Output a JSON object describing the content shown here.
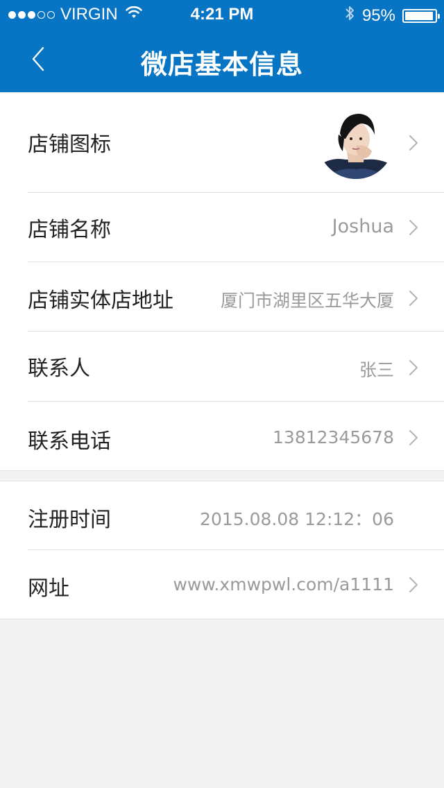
{
  "status_bar": {
    "carrier": "VIRGIN",
    "time": "4:21 PM",
    "battery_percent": "95%",
    "battery_level": 0.95,
    "signal_bars_filled": 3,
    "signal_bars_total": 5,
    "icons": [
      "wifi-icon",
      "bluetooth-icon",
      "battery-icon"
    ]
  },
  "nav": {
    "title": "微店基本信息",
    "back_icon": "chevron-left-icon"
  },
  "rows": {
    "shop_icon": {
      "label": "店铺图标",
      "value_type": "avatar-image"
    },
    "shop_name": {
      "label": "店铺名称",
      "value": "Joshua"
    },
    "shop_address": {
      "label": "店铺实体店地址",
      "value": "厦门市湖里区五华大厦"
    },
    "contact": {
      "label": "联系人",
      "value": "张三"
    },
    "phone": {
      "label": "联系电话",
      "value": "13812345678"
    },
    "register_time": {
      "label": "注册时间",
      "value": "2015.08.08  12:12：06"
    },
    "url": {
      "label": "网址",
      "value": "www.xmwpwl.com/a1111"
    }
  },
  "colors": {
    "primary": "#0774c4",
    "background": "#f3f3f3",
    "text": "#222222",
    "secondary_text": "#9a9a9a",
    "divider": "#e2e2e2"
  }
}
